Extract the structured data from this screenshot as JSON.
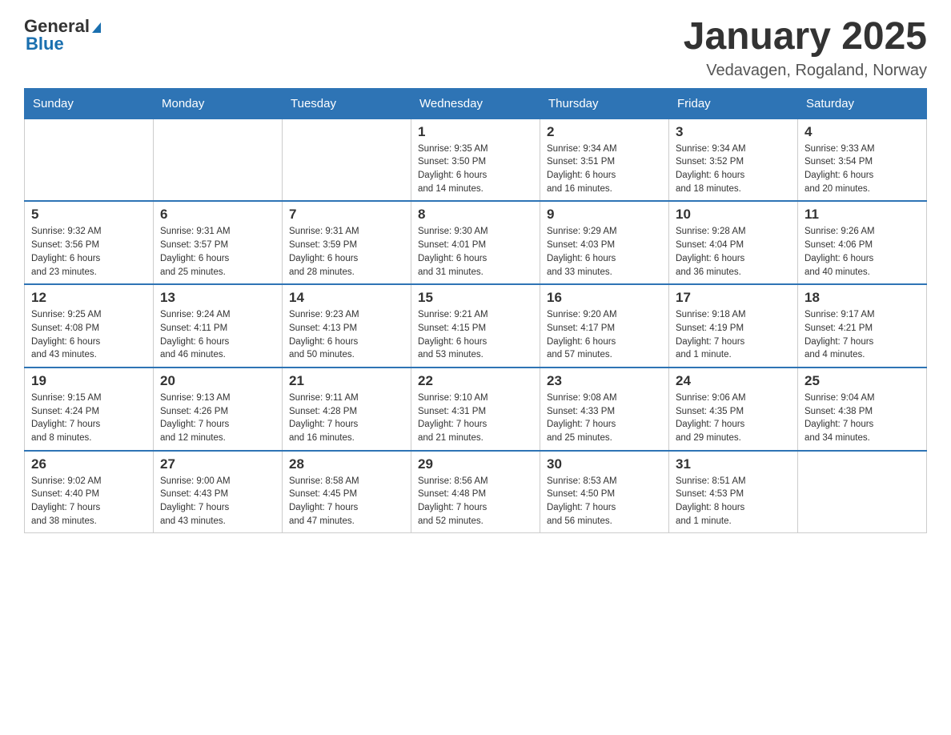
{
  "header": {
    "logo": {
      "text_general": "General",
      "text_blue": "Blue"
    },
    "title": "January 2025",
    "location": "Vedavagen, Rogaland, Norway"
  },
  "calendar": {
    "days_of_week": [
      "Sunday",
      "Monday",
      "Tuesday",
      "Wednesday",
      "Thursday",
      "Friday",
      "Saturday"
    ],
    "weeks": [
      {
        "days": [
          {
            "date": "",
            "info": ""
          },
          {
            "date": "",
            "info": ""
          },
          {
            "date": "",
            "info": ""
          },
          {
            "date": "1",
            "info": "Sunrise: 9:35 AM\nSunset: 3:50 PM\nDaylight: 6 hours\nand 14 minutes."
          },
          {
            "date": "2",
            "info": "Sunrise: 9:34 AM\nSunset: 3:51 PM\nDaylight: 6 hours\nand 16 minutes."
          },
          {
            "date": "3",
            "info": "Sunrise: 9:34 AM\nSunset: 3:52 PM\nDaylight: 6 hours\nand 18 minutes."
          },
          {
            "date": "4",
            "info": "Sunrise: 9:33 AM\nSunset: 3:54 PM\nDaylight: 6 hours\nand 20 minutes."
          }
        ]
      },
      {
        "days": [
          {
            "date": "5",
            "info": "Sunrise: 9:32 AM\nSunset: 3:56 PM\nDaylight: 6 hours\nand 23 minutes."
          },
          {
            "date": "6",
            "info": "Sunrise: 9:31 AM\nSunset: 3:57 PM\nDaylight: 6 hours\nand 25 minutes."
          },
          {
            "date": "7",
            "info": "Sunrise: 9:31 AM\nSunset: 3:59 PM\nDaylight: 6 hours\nand 28 minutes."
          },
          {
            "date": "8",
            "info": "Sunrise: 9:30 AM\nSunset: 4:01 PM\nDaylight: 6 hours\nand 31 minutes."
          },
          {
            "date": "9",
            "info": "Sunrise: 9:29 AM\nSunset: 4:03 PM\nDaylight: 6 hours\nand 33 minutes."
          },
          {
            "date": "10",
            "info": "Sunrise: 9:28 AM\nSunset: 4:04 PM\nDaylight: 6 hours\nand 36 minutes."
          },
          {
            "date": "11",
            "info": "Sunrise: 9:26 AM\nSunset: 4:06 PM\nDaylight: 6 hours\nand 40 minutes."
          }
        ]
      },
      {
        "days": [
          {
            "date": "12",
            "info": "Sunrise: 9:25 AM\nSunset: 4:08 PM\nDaylight: 6 hours\nand 43 minutes."
          },
          {
            "date": "13",
            "info": "Sunrise: 9:24 AM\nSunset: 4:11 PM\nDaylight: 6 hours\nand 46 minutes."
          },
          {
            "date": "14",
            "info": "Sunrise: 9:23 AM\nSunset: 4:13 PM\nDaylight: 6 hours\nand 50 minutes."
          },
          {
            "date": "15",
            "info": "Sunrise: 9:21 AM\nSunset: 4:15 PM\nDaylight: 6 hours\nand 53 minutes."
          },
          {
            "date": "16",
            "info": "Sunrise: 9:20 AM\nSunset: 4:17 PM\nDaylight: 6 hours\nand 57 minutes."
          },
          {
            "date": "17",
            "info": "Sunrise: 9:18 AM\nSunset: 4:19 PM\nDaylight: 7 hours\nand 1 minute."
          },
          {
            "date": "18",
            "info": "Sunrise: 9:17 AM\nSunset: 4:21 PM\nDaylight: 7 hours\nand 4 minutes."
          }
        ]
      },
      {
        "days": [
          {
            "date": "19",
            "info": "Sunrise: 9:15 AM\nSunset: 4:24 PM\nDaylight: 7 hours\nand 8 minutes."
          },
          {
            "date": "20",
            "info": "Sunrise: 9:13 AM\nSunset: 4:26 PM\nDaylight: 7 hours\nand 12 minutes."
          },
          {
            "date": "21",
            "info": "Sunrise: 9:11 AM\nSunset: 4:28 PM\nDaylight: 7 hours\nand 16 minutes."
          },
          {
            "date": "22",
            "info": "Sunrise: 9:10 AM\nSunset: 4:31 PM\nDaylight: 7 hours\nand 21 minutes."
          },
          {
            "date": "23",
            "info": "Sunrise: 9:08 AM\nSunset: 4:33 PM\nDaylight: 7 hours\nand 25 minutes."
          },
          {
            "date": "24",
            "info": "Sunrise: 9:06 AM\nSunset: 4:35 PM\nDaylight: 7 hours\nand 29 minutes."
          },
          {
            "date": "25",
            "info": "Sunrise: 9:04 AM\nSunset: 4:38 PM\nDaylight: 7 hours\nand 34 minutes."
          }
        ]
      },
      {
        "days": [
          {
            "date": "26",
            "info": "Sunrise: 9:02 AM\nSunset: 4:40 PM\nDaylight: 7 hours\nand 38 minutes."
          },
          {
            "date": "27",
            "info": "Sunrise: 9:00 AM\nSunset: 4:43 PM\nDaylight: 7 hours\nand 43 minutes."
          },
          {
            "date": "28",
            "info": "Sunrise: 8:58 AM\nSunset: 4:45 PM\nDaylight: 7 hours\nand 47 minutes."
          },
          {
            "date": "29",
            "info": "Sunrise: 8:56 AM\nSunset: 4:48 PM\nDaylight: 7 hours\nand 52 minutes."
          },
          {
            "date": "30",
            "info": "Sunrise: 8:53 AM\nSunset: 4:50 PM\nDaylight: 7 hours\nand 56 minutes."
          },
          {
            "date": "31",
            "info": "Sunrise: 8:51 AM\nSunset: 4:53 PM\nDaylight: 8 hours\nand 1 minute."
          },
          {
            "date": "",
            "info": ""
          }
        ]
      }
    ]
  }
}
